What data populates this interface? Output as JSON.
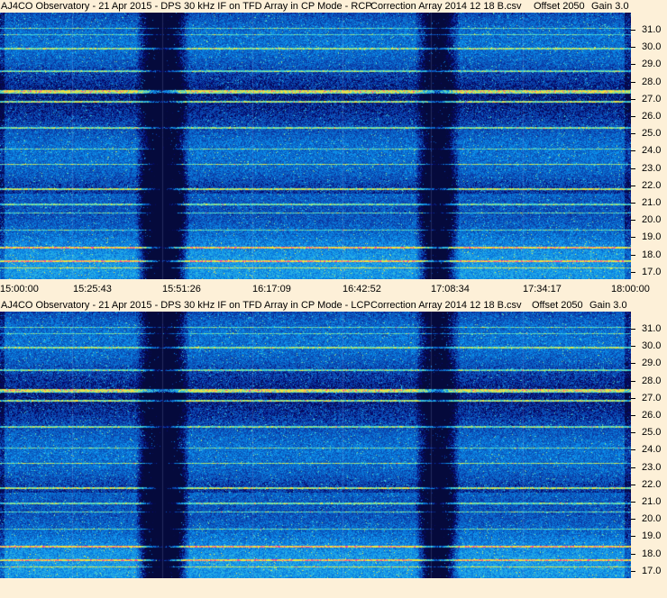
{
  "top_panel": {
    "title_left": "AJ4CO Observatory - 21 Apr 2015 - DPS 30 kHz IF on TFD Array in CP Mode - RCP",
    "correction": "Correction Array 2014 12 18 B.csv",
    "offset": "Offset 2050",
    "gain": "Gain 3.0"
  },
  "bottom_panel": {
    "title_left": "AJ4CO Observatory - 21 Apr 2015 - DPS 30 kHz IF on TFD Array in CP Mode - LCP",
    "correction": "Correction Array 2014 12 18 B.csv",
    "offset": "Offset 2050",
    "gain": "Gain 3.0"
  },
  "y_labels": [
    "31.0",
    "30.0",
    "29.0",
    "28.0",
    "27.0",
    "26.0",
    "25.0",
    "24.0",
    "23.0",
    "22.0",
    "21.0",
    "20.0",
    "19.0",
    "18.0",
    "17.0"
  ],
  "x_labels": [
    "15:00:00",
    "15:25:43",
    "15:51:26",
    "16:17:09",
    "16:42:52",
    "17:08:34",
    "17:34:17",
    "18:00:00"
  ],
  "colors": {
    "background": "#fdf0d8",
    "spectrogram_base": "#1a4fd0"
  }
}
